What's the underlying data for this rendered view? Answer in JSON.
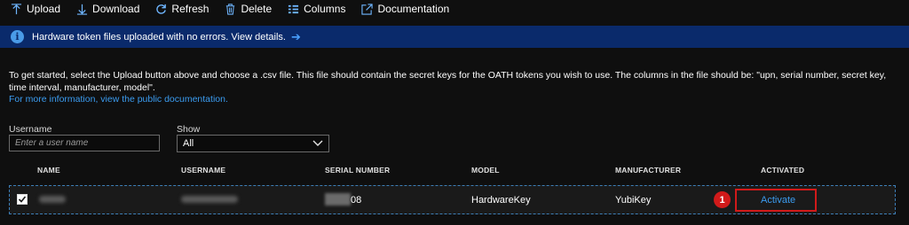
{
  "toolbar": {
    "upload": "Upload",
    "download": "Download",
    "refresh": "Refresh",
    "delete": "Delete",
    "columns": "Columns",
    "documentation": "Documentation"
  },
  "banner": {
    "message": "Hardware token files uploaded with no errors. View details.",
    "arrow": "➔",
    "color": "#0a2a6b"
  },
  "description": {
    "text": "To get started, select the Upload button above and choose a .csv file. This file should contain the secret keys for the OATH tokens you wish to use. The columns in the file should be: \"upn, serial number, secret key, time interval, manufacturer, model\".",
    "link": "For more information, view the public documentation."
  },
  "filters": {
    "username_label": "Username",
    "username_placeholder": "Enter a user name",
    "show_label": "Show",
    "show_value": "All"
  },
  "table": {
    "columns": [
      "NAME",
      "USERNAME",
      "SERIAL NUMBER",
      "MODEL",
      "MANUFACTURER",
      "ACTIVATED"
    ],
    "rows": [
      {
        "checked": true,
        "serial_suffix": "08",
        "model": "HardwareKey",
        "manufacturer": "YubiKey",
        "activated": "Activate"
      }
    ]
  },
  "callout": {
    "number": "1",
    "color": "#d11a1a"
  },
  "accent": "#3b9cf0"
}
